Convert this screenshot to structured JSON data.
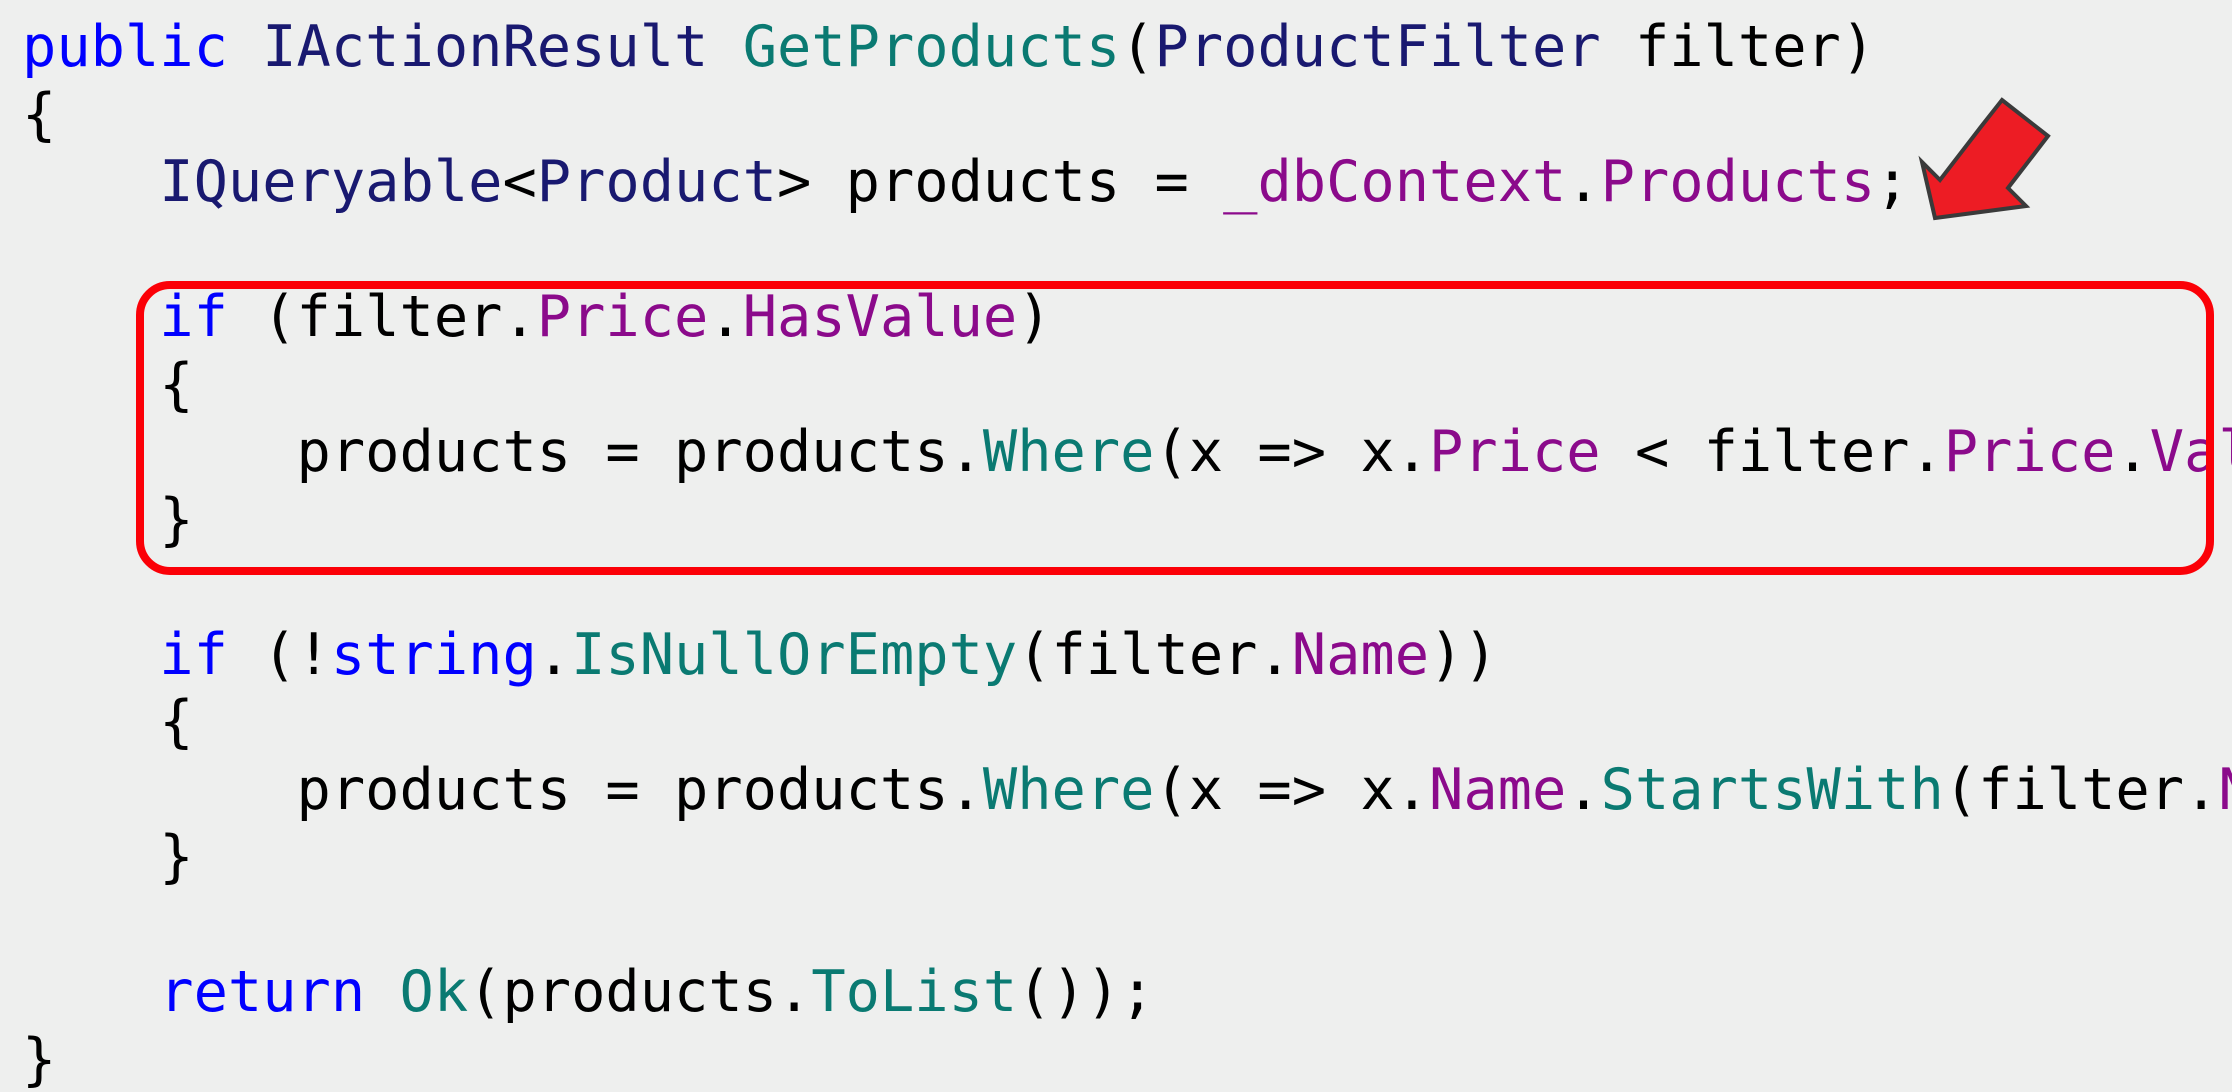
{
  "editor": {
    "background_color": "#eeefee",
    "language": "csharp",
    "font": "monospace",
    "syntax_colors": {
      "keyword": "#0000ff",
      "type": "#191970",
      "method": "#0a7a72",
      "property": "#8b0a8b",
      "plain": "#000000"
    }
  },
  "annotations": {
    "highlight_box": {
      "name": "price-filter-highlight",
      "color": "#fb0007",
      "stroke_width": 8,
      "corner_radius": 34,
      "covers_lines": [
        4,
        5,
        6,
        7
      ]
    },
    "arrow": {
      "name": "red-arrow",
      "fill_color": "#ed1c24",
      "outline_color": "#3a3a3a",
      "direction": "down-left"
    }
  },
  "code": {
    "lines": [
      {
        "index": 1,
        "indent": 0,
        "tokens": [
          {
            "t": "public",
            "k": "kw"
          },
          {
            "t": " ",
            "k": "plain"
          },
          {
            "t": "IActionResult",
            "k": "type"
          },
          {
            "t": " ",
            "k": "plain"
          },
          {
            "t": "GetProducts",
            "k": "fn"
          },
          {
            "t": "(",
            "k": "plain"
          },
          {
            "t": "ProductFilter",
            "k": "type"
          },
          {
            "t": " filter)",
            "k": "plain"
          }
        ]
      },
      {
        "index": 2,
        "indent": 0,
        "tokens": [
          {
            "t": "{",
            "k": "plain"
          }
        ]
      },
      {
        "index": 3,
        "indent": 1,
        "tokens": [
          {
            "t": "IQueryable",
            "k": "type"
          },
          {
            "t": "<",
            "k": "plain"
          },
          {
            "t": "Product",
            "k": "type"
          },
          {
            "t": "> products = ",
            "k": "plain"
          },
          {
            "t": "_dbContext",
            "k": "prop"
          },
          {
            "t": ".",
            "k": "plain"
          },
          {
            "t": "Products",
            "k": "prop"
          },
          {
            "t": ";",
            "k": "plain"
          }
        ]
      },
      {
        "index": 4,
        "indent": 0,
        "tokens": [
          {
            "t": "",
            "k": "plain"
          }
        ]
      },
      {
        "index": 5,
        "indent": 1,
        "tokens": [
          {
            "t": "if",
            "k": "kw"
          },
          {
            "t": " (filter.",
            "k": "plain"
          },
          {
            "t": "Price",
            "k": "prop"
          },
          {
            "t": ".",
            "k": "plain"
          },
          {
            "t": "HasValue",
            "k": "prop"
          },
          {
            "t": ")",
            "k": "plain"
          }
        ]
      },
      {
        "index": 6,
        "indent": 1,
        "tokens": [
          {
            "t": "{",
            "k": "plain"
          }
        ]
      },
      {
        "index": 7,
        "indent": 2,
        "tokens": [
          {
            "t": "products = products.",
            "k": "plain"
          },
          {
            "t": "Where",
            "k": "fn"
          },
          {
            "t": "(x => x.",
            "k": "plain"
          },
          {
            "t": "Price",
            "k": "prop"
          },
          {
            "t": " < filter.",
            "k": "plain"
          },
          {
            "t": "Price",
            "k": "prop"
          },
          {
            "t": ".",
            "k": "plain"
          },
          {
            "t": "Value",
            "k": "prop"
          },
          {
            "t": ");",
            "k": "plain"
          }
        ]
      },
      {
        "index": 8,
        "indent": 1,
        "tokens": [
          {
            "t": "}",
            "k": "plain"
          }
        ]
      },
      {
        "index": 9,
        "indent": 0,
        "tokens": [
          {
            "t": "",
            "k": "plain"
          }
        ]
      },
      {
        "index": 10,
        "indent": 1,
        "tokens": [
          {
            "t": "if",
            "k": "kw"
          },
          {
            "t": " (!",
            "k": "plain"
          },
          {
            "t": "string",
            "k": "kw"
          },
          {
            "t": ".",
            "k": "plain"
          },
          {
            "t": "IsNullOrEmpty",
            "k": "fn"
          },
          {
            "t": "(filter.",
            "k": "plain"
          },
          {
            "t": "Name",
            "k": "prop"
          },
          {
            "t": "))",
            "k": "plain"
          }
        ]
      },
      {
        "index": 11,
        "indent": 1,
        "tokens": [
          {
            "t": "{",
            "k": "plain"
          }
        ]
      },
      {
        "index": 12,
        "indent": 2,
        "tokens": [
          {
            "t": "products = products.",
            "k": "plain"
          },
          {
            "t": "Where",
            "k": "fn"
          },
          {
            "t": "(x => x.",
            "k": "plain"
          },
          {
            "t": "Name",
            "k": "prop"
          },
          {
            "t": ".",
            "k": "plain"
          },
          {
            "t": "StartsWith",
            "k": "fn"
          },
          {
            "t": "(filter.",
            "k": "plain"
          },
          {
            "t": "Name",
            "k": "prop"
          },
          {
            "t": "));",
            "k": "plain"
          }
        ]
      },
      {
        "index": 13,
        "indent": 1,
        "tokens": [
          {
            "t": "}",
            "k": "plain"
          }
        ]
      },
      {
        "index": 14,
        "indent": 0,
        "tokens": [
          {
            "t": "",
            "k": "plain"
          }
        ]
      },
      {
        "index": 15,
        "indent": 1,
        "tokens": [
          {
            "t": "return",
            "k": "kw"
          },
          {
            "t": " ",
            "k": "plain"
          },
          {
            "t": "Ok",
            "k": "fn"
          },
          {
            "t": "(products.",
            "k": "plain"
          },
          {
            "t": "ToList",
            "k": "fn"
          },
          {
            "t": "());",
            "k": "plain"
          }
        ]
      },
      {
        "index": 16,
        "indent": 0,
        "tokens": [
          {
            "t": "}",
            "k": "plain"
          }
        ]
      }
    ]
  }
}
